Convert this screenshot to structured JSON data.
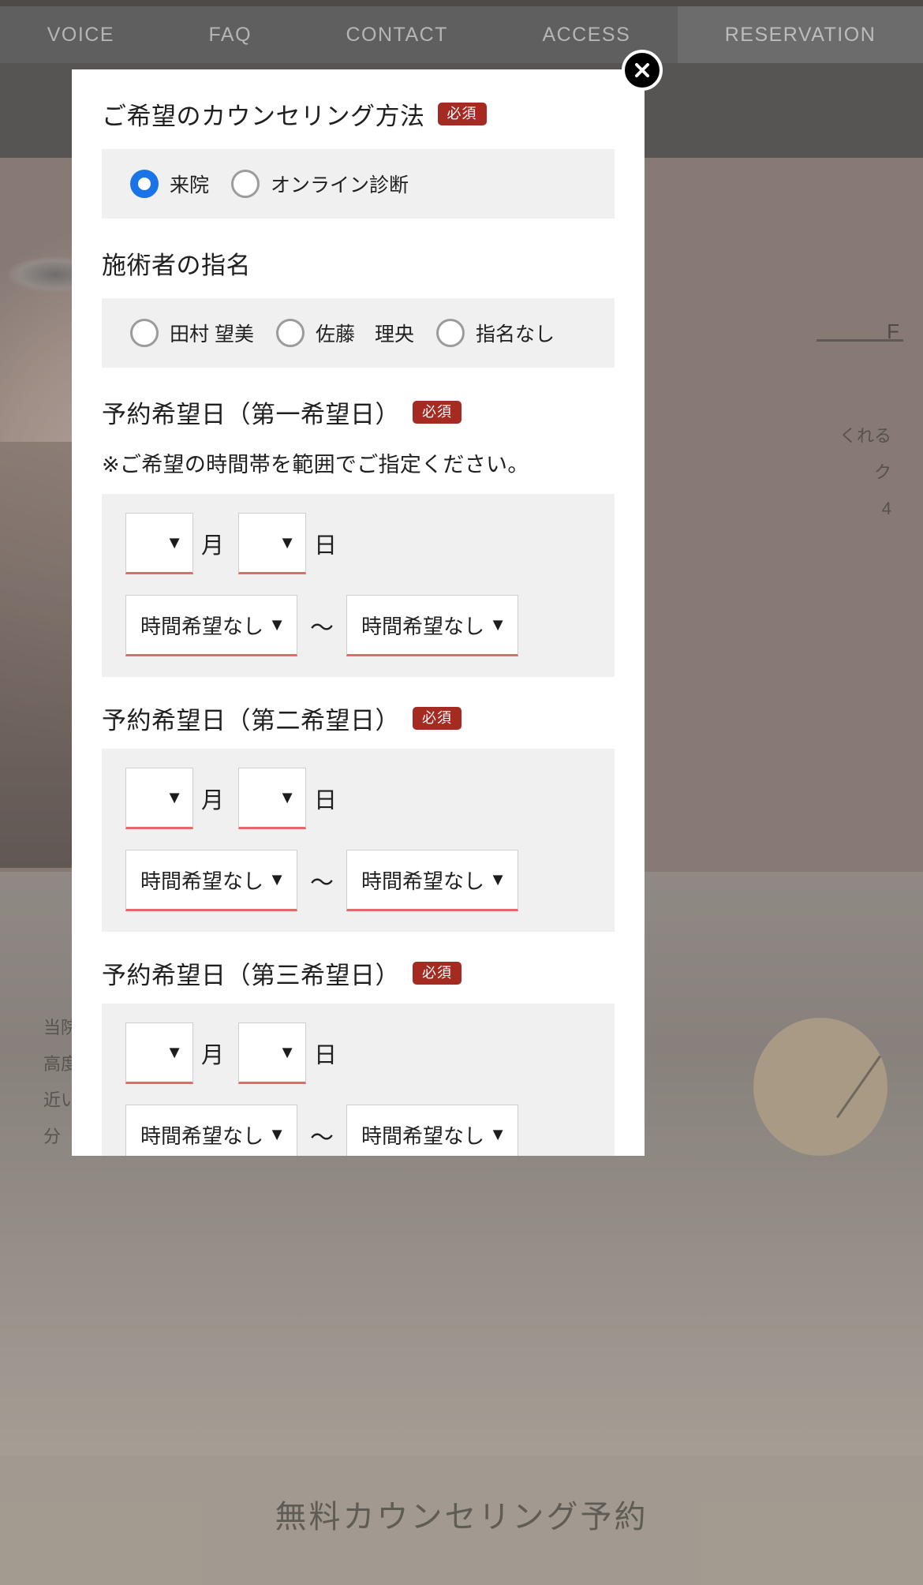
{
  "nav": {
    "items": [
      {
        "label": "VOICE",
        "active": false
      },
      {
        "label": "FAQ",
        "active": false
      },
      {
        "label": "CONTACT",
        "active": false
      },
      {
        "label": "ACCESS",
        "active": false
      },
      {
        "label": "RESERVATION",
        "active": true
      }
    ]
  },
  "background": {
    "rule_label": "F",
    "text_col": "くれる\nク\n4",
    "left_lines": "当院\n高度\n近い\n分",
    "footer_cta": "無料カウンセリング予約"
  },
  "modal": {
    "close_icon": "close-icon",
    "sections": {
      "counseling_method": {
        "title": "ご希望のカウンセリング方法",
        "required_badge": "必須",
        "options": [
          {
            "label": "来院",
            "checked": true
          },
          {
            "label": "オンライン診断",
            "checked": false
          }
        ]
      },
      "practitioner": {
        "title": "施術者の指名",
        "required_badge": "",
        "options": [
          {
            "label": "田村 望美",
            "checked": false
          },
          {
            "label": "佐藤　理央",
            "checked": false
          },
          {
            "label": "指名なし",
            "checked": false
          }
        ]
      },
      "date_first": {
        "title": "予約希望日（第一希望日）",
        "required_badge": "必須",
        "note": "※ご希望の時間帯を範囲でご指定ください。",
        "month_value": "",
        "month_unit": "月",
        "day_value": "",
        "day_unit": "日",
        "time_from": "時間希望なし",
        "time_separator": "〜",
        "time_to": "時間希望なし",
        "caret": "▼"
      },
      "date_second": {
        "title": "予約希望日（第二希望日）",
        "required_badge": "必須",
        "note": "",
        "month_value": "",
        "month_unit": "月",
        "day_value": "",
        "day_unit": "日",
        "time_from": "時間希望なし",
        "time_separator": "〜",
        "time_to": "時間希望なし",
        "caret": "▼"
      },
      "date_third": {
        "title": "予約希望日（第三希望日）",
        "required_badge": "必須",
        "note": "",
        "month_value": "",
        "month_unit": "月",
        "day_value": "",
        "day_unit": "日",
        "time_from": "時間希望なし",
        "time_separator": "〜",
        "time_to": "時間希望なし",
        "caret": "▼"
      }
    }
  },
  "colors": {
    "badge_red": "#a52a21",
    "radio_blue": "#1a73e8",
    "field_underline_red": "#e06b6b",
    "field_bg_gray": "#f0f0f0",
    "nav_bg": "#58585a",
    "nav_active_bg": "#6a6a6c"
  }
}
